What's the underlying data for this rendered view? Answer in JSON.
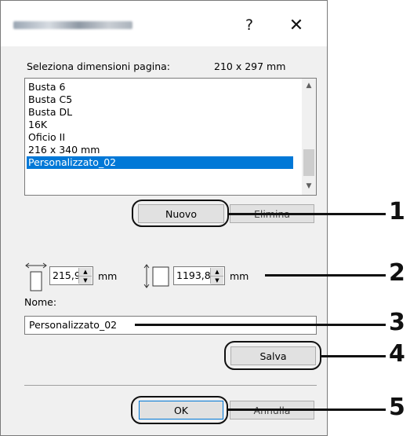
{
  "titlebar": {
    "title": "",
    "help_glyph": "?",
    "close_glyph": "✕"
  },
  "page_size": {
    "label": "Seleziona dimensioni pagina:",
    "current": "210 x 297 mm"
  },
  "paper_list": {
    "items": [
      "Busta 6",
      "Busta C5",
      "Busta DL",
      "16K",
      "Oficio II",
      "216 x 340 mm",
      "Personalizzato_02"
    ],
    "selected": "Personalizzato_02"
  },
  "buttons": {
    "new": "Nuovo",
    "delete": "Elimina",
    "save": "Salva",
    "ok": "OK",
    "cancel": "Annulla"
  },
  "dimensions": {
    "width_value": "215,9",
    "width_unit": "mm",
    "height_value": "1193,8",
    "height_unit": "mm"
  },
  "name_field": {
    "label": "Nome:",
    "value": "Personalizzato_02"
  },
  "callouts": [
    "1",
    "2",
    "3",
    "4",
    "5"
  ],
  "colors": {
    "selection": "#0078d7",
    "dialog_bg": "#f0f0f0",
    "callout": "#111111"
  }
}
